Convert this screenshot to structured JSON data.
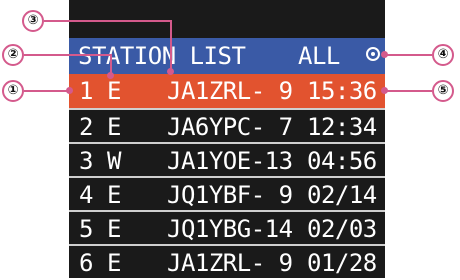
{
  "header": {
    "title": "STATION LIST",
    "filter": "ALL"
  },
  "rows": [
    {
      "index": "1",
      "type": "E",
      "callsign": "JA1ZRL- 9",
      "time": "15:36",
      "selected": true
    },
    {
      "index": "2",
      "type": "E",
      "callsign": "JA6YPC- 7",
      "time": "12:34",
      "selected": false
    },
    {
      "index": "3",
      "type": "W",
      "callsign": "JA1YOE-13",
      "time": "04:56",
      "selected": false
    },
    {
      "index": "4",
      "type": "E",
      "callsign": "JQ1YBF- 9",
      "time": "02/14",
      "selected": false
    },
    {
      "index": "5",
      "type": "E",
      "callsign": "JQ1YBG-14",
      "time": "02/03",
      "selected": false
    },
    {
      "index": "6",
      "type": "E",
      "callsign": "JA1ZRL- 9",
      "time": "01/28",
      "selected": false
    }
  ],
  "callouts": [
    "①",
    "②",
    "③",
    "④",
    "⑤"
  ],
  "colors": {
    "header_bg": "#3a5aa6",
    "selected_row_bg": "#e2532f",
    "row_bg": "#1a1a1a",
    "callout": "#d45a8c"
  }
}
